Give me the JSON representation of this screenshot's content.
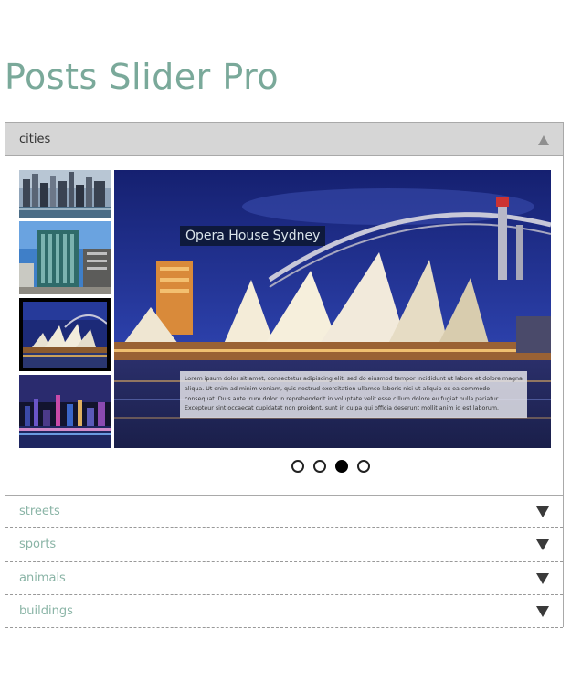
{
  "page": {
    "title": "Posts Slider Pro"
  },
  "accordion": {
    "active": {
      "label": "cities",
      "slide": {
        "title": "Opera House Sydney",
        "description": "Lorem ipsum dolor sit amet, consectetur adipiscing elit, sed do eiusmod tempor incididunt ut labore et dolore magna aliqua. Ut enim ad minim veniam, quis nostrud exercitation ullamco laboris nisi ut aliquip ex ea commodo consequat. Duis aute irure dolor in reprehenderit in voluptate velit esse cillum dolore eu fugiat nulla pariatur. Excepteur sint occaecat cupidatat non proident, sunt in culpa qui officia deserunt mollit anim id est laborum."
      },
      "thumbnails": [
        {
          "name": "city-skyline-thumbnail"
        },
        {
          "name": "office-tower-thumbnail"
        },
        {
          "name": "opera-house-thumbnail",
          "selected": true
        },
        {
          "name": "night-skyline-thumbnail"
        }
      ],
      "pager": {
        "count": 4,
        "current": 3
      }
    },
    "items": [
      {
        "label": "streets"
      },
      {
        "label": "sports"
      },
      {
        "label": "animals"
      },
      {
        "label": "buildings"
      }
    ]
  },
  "colors": {
    "title": "#7aa99a",
    "item_label": "#8ab4a6",
    "active_header_bg": "#d6d6d6"
  },
  "icons": {
    "expanded": "triangle-up-icon",
    "collapsed": "triangle-down-icon"
  }
}
